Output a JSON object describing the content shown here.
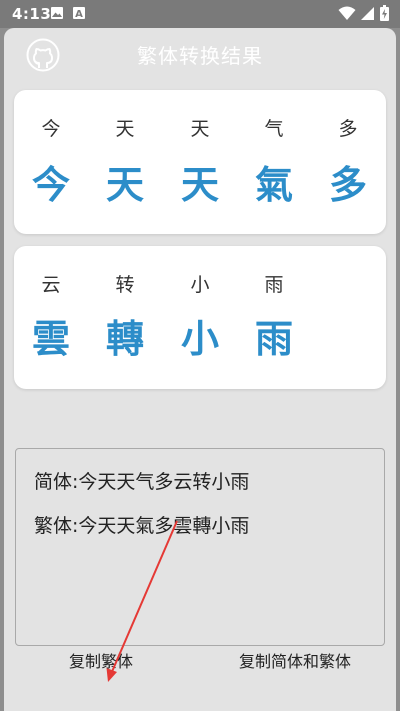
{
  "status_bar": {
    "time": "4:13",
    "left_icons": [
      "image-icon",
      "font-a-icon"
    ],
    "right_icons": [
      "wifi-icon",
      "signal-icon",
      "battery-icon"
    ]
  },
  "header": {
    "title": "繁体转换结果",
    "icon": "github-icon"
  },
  "cards": [
    {
      "pairs": [
        {
          "simplified": "今",
          "traditional": "今"
        },
        {
          "simplified": "天",
          "traditional": "天"
        },
        {
          "simplified": "天",
          "traditional": "天"
        },
        {
          "simplified": "气",
          "traditional": "氣"
        },
        {
          "simplified": "多",
          "traditional": "多"
        }
      ]
    },
    {
      "pairs": [
        {
          "simplified": "云",
          "traditional": "雲"
        },
        {
          "simplified": "转",
          "traditional": "轉"
        },
        {
          "simplified": "小",
          "traditional": "小"
        },
        {
          "simplified": "雨",
          "traditional": "雨"
        }
      ]
    }
  ],
  "result": {
    "simplified_line": "简体:今天天气多云转小雨",
    "traditional_line": "繁体:今天天氣多雲轉小雨"
  },
  "buttons": {
    "copy_traditional": "复制繁体",
    "copy_both": "复制简体和繁体"
  },
  "colors": {
    "accent": "#2c8dc9",
    "annotation_arrow": "#e53935"
  }
}
